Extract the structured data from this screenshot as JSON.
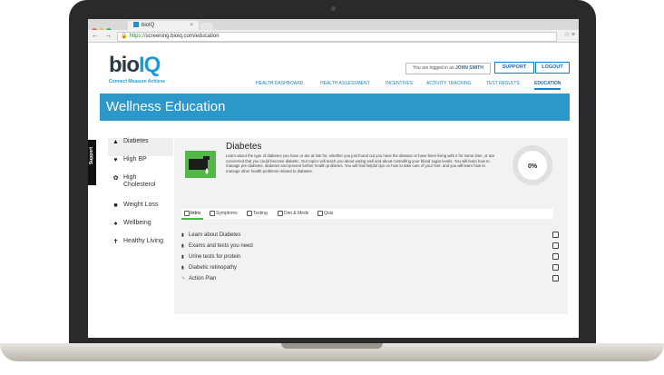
{
  "browser": {
    "tab_title": "bioIQ",
    "tab_close": "×",
    "url_https": "https://",
    "url_rest": "screening.bioiq.com/education",
    "nav_glyphs": "← → C",
    "tools_glyphs": "☆ ≡"
  },
  "header": {
    "logo_bio": "bio",
    "logo_iq": "IQ",
    "tagline": "Connect Measure Achieve",
    "logged_in_prefix": "You are logged in as ",
    "logged_in_user": "JOHN SMITH",
    "support_label": "SUPPORT",
    "logout_label": "LOGOUT",
    "nav": [
      "HEALTH DASHBOARD",
      "HEALTH ASSESSMENT",
      "INCENTIVES",
      "ACTIVITY TRACKING",
      "TEST RESULTS",
      "EDUCATION"
    ],
    "active_nav": "EDUCATION"
  },
  "page_title": "Wellness Education",
  "support_tab": "Support",
  "sidebar": {
    "items": [
      {
        "label": "Diabetes",
        "icon": "diabetes-icon",
        "active": true
      },
      {
        "label": "High BP",
        "icon": "heart-icon"
      },
      {
        "label": "High Cholesterol",
        "icon": "cholesterol-icon"
      },
      {
        "label": "Weight Loss",
        "icon": "scale-icon"
      },
      {
        "label": "Wellbeing",
        "icon": "wellbeing-icon"
      },
      {
        "label": "Healthy Living",
        "icon": "healthy-living-icon"
      }
    ]
  },
  "topic": {
    "title": "Diabetes",
    "description": "Learn about the type of diabetes you have or are at risk for, whether you just found out you have the disease or have been living with it for some time, or are concerned that you could become diabetic. Our topics will teach you about eating well and about controlling your blood sugar levels. You will learn how to manage pre-diabetes, diabetes and prevent further health problems. You will find helpful tips on how to take care of your feet, and you will learn how to manage other health problems related to diabetes.",
    "progress": "0%",
    "progress_value": 0
  },
  "tabs": [
    "Intro",
    "Symptoms",
    "Testing",
    "Diet & Meds",
    "Quiz"
  ],
  "active_tab": "Intro",
  "lessons": [
    {
      "label": "Learn about Diabetes",
      "icon": "document-icon"
    },
    {
      "label": "Exams and tests you need",
      "icon": "document-icon"
    },
    {
      "label": "Urine tests for protein",
      "icon": "document-icon"
    },
    {
      "label": "Diabetic retinopathy",
      "icon": "document-icon"
    },
    {
      "label": "Action Plan",
      "icon": "pencil-icon"
    }
  ],
  "colors": {
    "brand_blue": "#2c97c9",
    "accent_green": "#51b848",
    "laptop_frame": "#2a2a2c"
  }
}
